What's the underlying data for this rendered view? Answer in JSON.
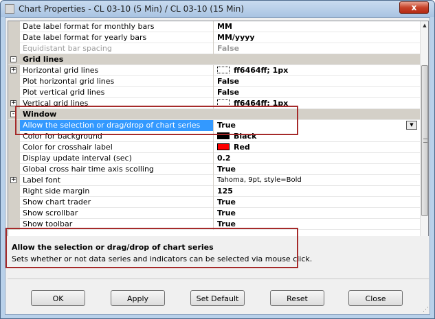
{
  "window": {
    "title": "Chart Properties - CL 03-10 (5 Min) / CL 03-10 (15 Min)",
    "close_glyph": "x"
  },
  "grid": {
    "rows": [
      {
        "kind": "prop",
        "name": "Date label format for monthly bars",
        "value": "MM"
      },
      {
        "kind": "prop",
        "name": "Date label format for yearly bars",
        "value": "MM/yyyy"
      },
      {
        "kind": "prop",
        "name": "Equidistant bar spacing",
        "value": "False",
        "disabled": true
      },
      {
        "kind": "category",
        "name": "Grid lines",
        "expander": "-"
      },
      {
        "kind": "prop",
        "name": "Horizontal grid lines",
        "value": "ff6464ff; 1px",
        "expander": "+",
        "swatch": "dotted"
      },
      {
        "kind": "prop",
        "name": "Plot horizontal grid lines",
        "value": "False"
      },
      {
        "kind": "prop",
        "name": "Plot vertical grid lines",
        "value": "False"
      },
      {
        "kind": "prop",
        "name": "Vertical grid lines",
        "value": "ff6464ff; 1px",
        "expander": "+",
        "swatch": "dotted"
      },
      {
        "kind": "category",
        "name": "Window",
        "expander": "-"
      },
      {
        "kind": "prop",
        "name": "Allow the selection or drag/drop of chart series",
        "value": "True",
        "selected": true
      },
      {
        "kind": "prop",
        "name": "Color for background",
        "value": "Black",
        "swatch": "#000000"
      },
      {
        "kind": "prop",
        "name": "Color for crosshair label",
        "value": "Red",
        "swatch": "#ff0000"
      },
      {
        "kind": "prop",
        "name": "Display update interval (sec)",
        "value": "0.2"
      },
      {
        "kind": "prop",
        "name": "Global cross hair time axis scolling",
        "value": "True"
      },
      {
        "kind": "prop",
        "name": "Label font",
        "value": "Tahoma, 9pt, style=Bold",
        "expander": "+",
        "normal": true
      },
      {
        "kind": "prop",
        "name": "Right side margin",
        "value": "125"
      },
      {
        "kind": "prop",
        "name": "Show chart trader",
        "value": "True"
      },
      {
        "kind": "prop",
        "name": "Show scrollbar",
        "value": "True"
      },
      {
        "kind": "prop",
        "name": "Show toolbar",
        "value": "True"
      }
    ]
  },
  "description": {
    "title": "Allow the selection or drag/drop of chart series",
    "text": "Sets whether or not data series and indicators can be selected via mouse click."
  },
  "buttons": {
    "ok": "OK",
    "apply": "Apply",
    "set_default": "Set Default",
    "reset": "Reset",
    "close": "Close"
  },
  "colors": {
    "selection": "#3399ff",
    "highlight_border": "#a52a2a",
    "category_bg": "#d4d0c8"
  }
}
